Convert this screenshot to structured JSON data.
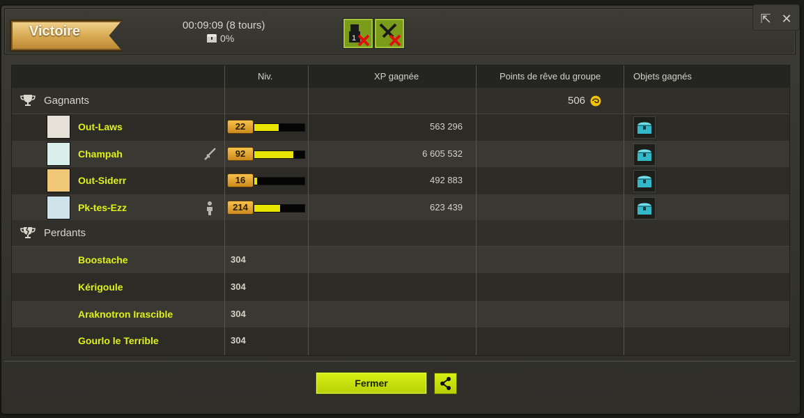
{
  "header": {
    "result": "Victoire",
    "duration": "00:09:09 (8 tours)",
    "chest_percent": "0%"
  },
  "columns": {
    "level": "Niv.",
    "xp": "XP gagnée",
    "dream_points": "Points de rêve du groupe",
    "items": "Objets gagnés"
  },
  "winners": {
    "label": "Gagnants",
    "dream_points": "506",
    "players": [
      {
        "name": "Out-Laws",
        "level": "22",
        "xp": "563 296",
        "xp_fill": 0.48,
        "status_icon": "",
        "item_icon": "chest-icon"
      },
      {
        "name": "Champah",
        "level": "92",
        "xp": "6 605 532",
        "xp_fill": 0.78,
        "status_icon": "sword-icon",
        "item_icon": "chest-icon"
      },
      {
        "name": "Out-Siderr",
        "level": "16",
        "xp": "492 883",
        "xp_fill": 0.06,
        "status_icon": "",
        "item_icon": "chest-icon"
      },
      {
        "name": "Pk-tes-Ezz",
        "level": "214",
        "xp": "623 439",
        "xp_fill": 0.52,
        "status_icon": "person-icon",
        "item_icon": "chest-icon"
      }
    ]
  },
  "losers": {
    "label": "Perdants",
    "monsters": [
      {
        "name": "Boostache",
        "level": "304"
      },
      {
        "name": "Kérigoule",
        "level": "304"
      },
      {
        "name": "Araknotron Irascible",
        "level": "304"
      },
      {
        "name": "Gourlo le Terrible",
        "level": "304"
      }
    ]
  },
  "footer": {
    "close_label": "Fermer",
    "share_icon": "share-icon"
  },
  "colors": {
    "accent": "#c9e30c",
    "name": "#dff21a",
    "level_badge": "#e6a838"
  }
}
